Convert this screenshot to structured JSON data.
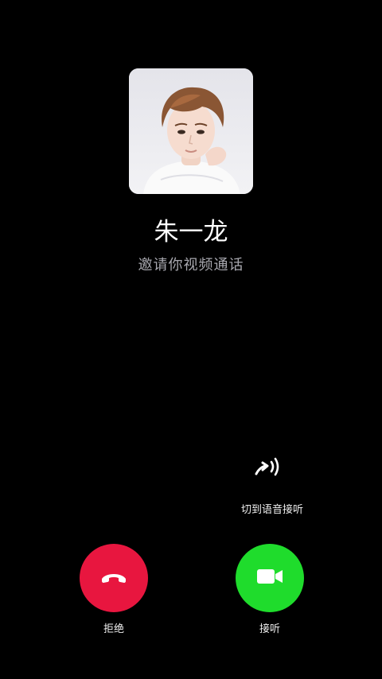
{
  "caller": {
    "name": "朱一龙",
    "subtitle": "邀请你视频通话"
  },
  "voice_switch": {
    "label": "切到语音接听",
    "icon": "voice-switch-icon"
  },
  "actions": {
    "decline_label": "拒绝",
    "accept_label": "接听",
    "decline_icon": "hang-up-phone-icon",
    "accept_icon": "video-camera-icon"
  },
  "colors": {
    "background": "#000000",
    "decline": "#e8163f",
    "accept": "#1fdc2c",
    "subtitle": "#a7a7ae"
  }
}
